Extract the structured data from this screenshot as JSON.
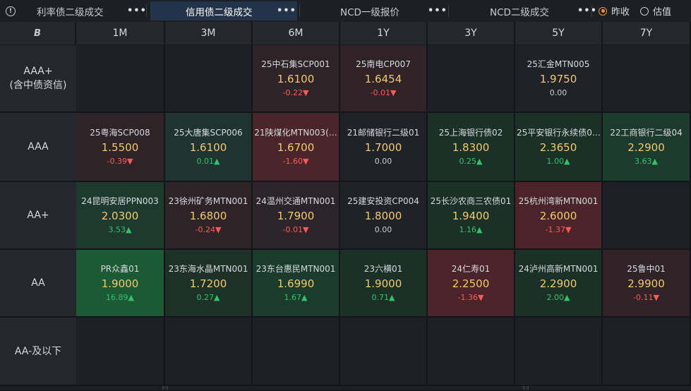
{
  "tabs": [
    {
      "label": "利率债二级成交",
      "more": "•••"
    },
    {
      "label": "信用债二级成交",
      "more": "•••"
    },
    {
      "label": "NCD一级报价",
      "more": "•••"
    },
    {
      "label": "NCD二级成交",
      "more": "•••"
    }
  ],
  "radios": [
    {
      "label": "昨收",
      "selected": true
    },
    {
      "label": "估值",
      "selected": false
    }
  ],
  "grid": {
    "corner_label": "B",
    "columns": [
      "1M",
      "3M",
      "6M",
      "1Y",
      "3Y",
      "5Y",
      "7Y"
    ],
    "rows": [
      {
        "label_line1": "AAA+",
        "label_line2": "(含中债资信)"
      },
      {
        "label_line1": "AAA",
        "label_line2": ""
      },
      {
        "label_line1": "AA+",
        "label_line2": ""
      },
      {
        "label_line1": "AA",
        "label_line2": ""
      },
      {
        "label_line1": "AA-及以下",
        "label_line2": ""
      }
    ],
    "cells": [
      [
        null,
        null,
        {
          "name": "25中石集SCP001",
          "yield": "1.6100",
          "change": "-0.22▼",
          "dir": "down"
        },
        {
          "name": "25南电CP007",
          "yield": "1.6454",
          "change": "-0.01▼",
          "dir": "down"
        },
        null,
        {
          "name": "25汇金MTN005",
          "yield": "1.9750",
          "change": "0.00",
          "dir": "flat"
        },
        null
      ],
      [
        {
          "name": "25粤海SCP008",
          "yield": "1.5500",
          "change": "-0.39▼",
          "dir": "down"
        },
        {
          "name": "25大唐集SCP006",
          "yield": "1.6100",
          "change": "0.01▲",
          "dir": "up"
        },
        {
          "name": "21陕煤化MTN003(…",
          "yield": "1.6700",
          "change": "-1.60▼",
          "dir": "down"
        },
        {
          "name": "21邮储银行二级01",
          "yield": "1.7000",
          "change": "0.00",
          "dir": "flat"
        },
        {
          "name": "25上海银行债02",
          "yield": "1.8300",
          "change": "0.25▲",
          "dir": "up"
        },
        {
          "name": "25平安银行永续债0…",
          "yield": "2.3650",
          "change": "1.00▲",
          "dir": "up"
        },
        {
          "name": "22工商银行二级04",
          "yield": "2.2900",
          "change": "3.63▲",
          "dir": "up"
        }
      ],
      [
        {
          "name": "24昆明安居PPN003",
          "yield": "2.0300",
          "change": "3.53▲",
          "dir": "up"
        },
        {
          "name": "23徐州矿务MTN001",
          "yield": "1.6800",
          "change": "-0.24▼",
          "dir": "down"
        },
        {
          "name": "24温州交通MTN001",
          "yield": "1.7900",
          "change": "-0.01▼",
          "dir": "down"
        },
        {
          "name": "25建安投资CP004",
          "yield": "1.8000",
          "change": "0.00",
          "dir": "flat"
        },
        {
          "name": "25长沙农商三农债01",
          "yield": "1.9400",
          "change": "1.16▲",
          "dir": "up"
        },
        {
          "name": "25杭州湾新MTN001",
          "yield": "2.6000",
          "change": "-1.37▼",
          "dir": "down"
        },
        null
      ],
      [
        {
          "name": "PR众鑫01",
          "yield": "1.9000",
          "change": "16.89▲",
          "dir": "up"
        },
        {
          "name": "23东海水晶MTN001",
          "yield": "1.7200",
          "change": "0.27▲",
          "dir": "up"
        },
        {
          "name": "23东台惠民MTN001",
          "yield": "1.6990",
          "change": "1.67▲",
          "dir": "up"
        },
        {
          "name": "23六横01",
          "yield": "1.9000",
          "change": "0.71▲",
          "dir": "up"
        },
        {
          "name": "24仁寿01",
          "yield": "2.2500",
          "change": "-1.36▼",
          "dir": "down"
        },
        {
          "name": "24泸州高新MTN001",
          "yield": "2.2900",
          "change": "2.00▲",
          "dir": "up"
        },
        {
          "name": "25鲁中01",
          "yield": "2.9900",
          "change": "-0.11▼",
          "dir": "down"
        }
      ],
      [
        null,
        null,
        null,
        null,
        null,
        null,
        null
      ]
    ],
    "cell_colors": [
      [
        "#1d2026",
        "#1d2026",
        "#2e2428",
        "#2f2327",
        "#1d2026",
        "#1f2329",
        "#1d2026"
      ],
      [
        "#2e2428",
        "#1f3430",
        "#4a2529",
        "#1f2329",
        "#1b3128",
        "#1b3128",
        "#1d3a2e"
      ],
      [
        "#1e3a2e",
        "#2e2428",
        "#2c2428",
        "#1f2329",
        "#1b3128",
        "#4a2429",
        "#1d2026"
      ],
      [
        "#1b5a34",
        "#1e3128",
        "#1b3b2c",
        "#1b3128",
        "#4a2429",
        "#1b3128",
        "#2f2327"
      ],
      [
        "#1d2026",
        "#1d2026",
        "#1d2026",
        "#1d2026",
        "#1d2026",
        "#1d2026",
        "#1d2026"
      ]
    ]
  }
}
